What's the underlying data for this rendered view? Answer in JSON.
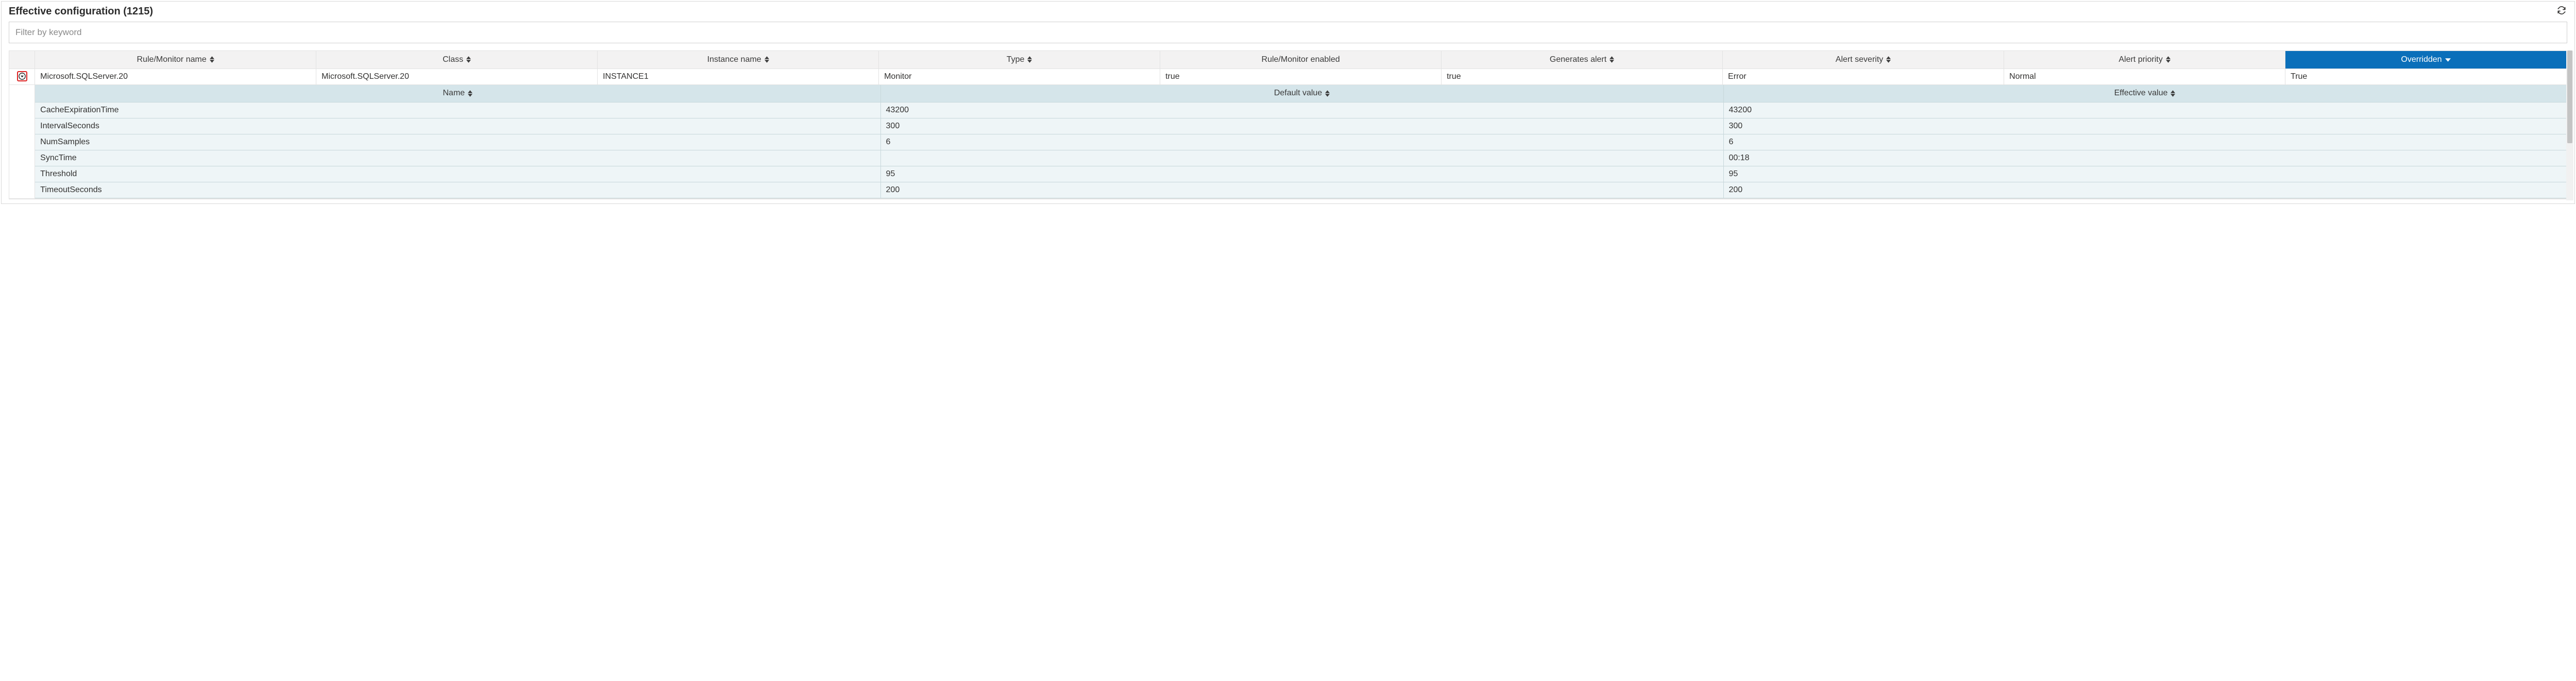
{
  "header": {
    "title_prefix": "Effective configuration",
    "count": "1215"
  },
  "filter": {
    "placeholder": "Filter by keyword",
    "value": ""
  },
  "columns": [
    {
      "label": "Rule/Monitor name",
      "sortable": true,
      "active": false
    },
    {
      "label": "Class",
      "sortable": true,
      "active": false
    },
    {
      "label": "Instance name",
      "sortable": true,
      "active": false
    },
    {
      "label": "Type",
      "sortable": true,
      "active": false
    },
    {
      "label": "Rule/Monitor enabled",
      "sortable": false,
      "active": false
    },
    {
      "label": "Generates alert",
      "sortable": true,
      "active": false
    },
    {
      "label": "Alert severity",
      "sortable": true,
      "active": false
    },
    {
      "label": "Alert priority",
      "sortable": true,
      "active": false
    },
    {
      "label": "Overridden",
      "sortable": false,
      "active": true,
      "sort_dir": "desc"
    }
  ],
  "rows": [
    {
      "rule_monitor_name": "Microsoft.SQLServer.20",
      "class": "Microsoft.SQLServer.20",
      "instance_name": "INSTANCE1",
      "type": "Monitor",
      "enabled": "true",
      "generates_alert": "true",
      "alert_severity": "Error",
      "alert_priority": "Normal",
      "overridden": "True"
    }
  ],
  "detail_columns": [
    {
      "label": "Name"
    },
    {
      "label": "Default value"
    },
    {
      "label": "Effective value"
    }
  ],
  "details": [
    {
      "name": "CacheExpirationTime",
      "default": "43200",
      "effective": "43200"
    },
    {
      "name": "IntervalSeconds",
      "default": "300",
      "effective": "300"
    },
    {
      "name": "NumSamples",
      "default": "6",
      "effective": "6"
    },
    {
      "name": "SyncTime",
      "default": "",
      "effective": "00:18"
    },
    {
      "name": "Threshold",
      "default": "95",
      "effective": "95"
    },
    {
      "name": "TimeoutSeconds",
      "default": "200",
      "effective": "200"
    }
  ]
}
